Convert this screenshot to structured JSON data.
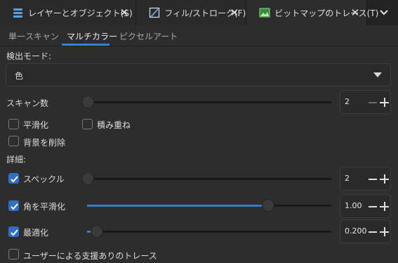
{
  "dock_tabs": [
    {
      "label": "レイヤーとオブジェクト(S)",
      "icon": "layers-icon"
    },
    {
      "label": "フィル/ストローク(F)",
      "icon": "fill-stroke-icon"
    },
    {
      "label": "ビットマップのトレース(T)",
      "icon": "trace-bitmap-icon"
    }
  ],
  "sub_tabs": [
    "単一スキャン",
    "マルチカラー",
    "ピクセルアート"
  ],
  "detection": {
    "label": "検出モード:",
    "value": "色"
  },
  "scans": {
    "label": "スキャン数",
    "value": "2"
  },
  "options": {
    "smooth": "平滑化",
    "stack": "積み重ね",
    "remove_bg": "背景を削除"
  },
  "details_label": "詳細:",
  "speckles": {
    "label": "スペックル",
    "value": "2"
  },
  "smooth_corners": {
    "label": "角を平滑化",
    "value": "1.00",
    "fraction": 0.74
  },
  "optimize": {
    "label": "最適化",
    "value": "0.200",
    "fraction": 0.04
  },
  "assisted": {
    "label": "ユーザーによる支援ありのトレース"
  },
  "colors": {
    "accent": "#3d7fd6",
    "background": "#2d2d2d"
  }
}
